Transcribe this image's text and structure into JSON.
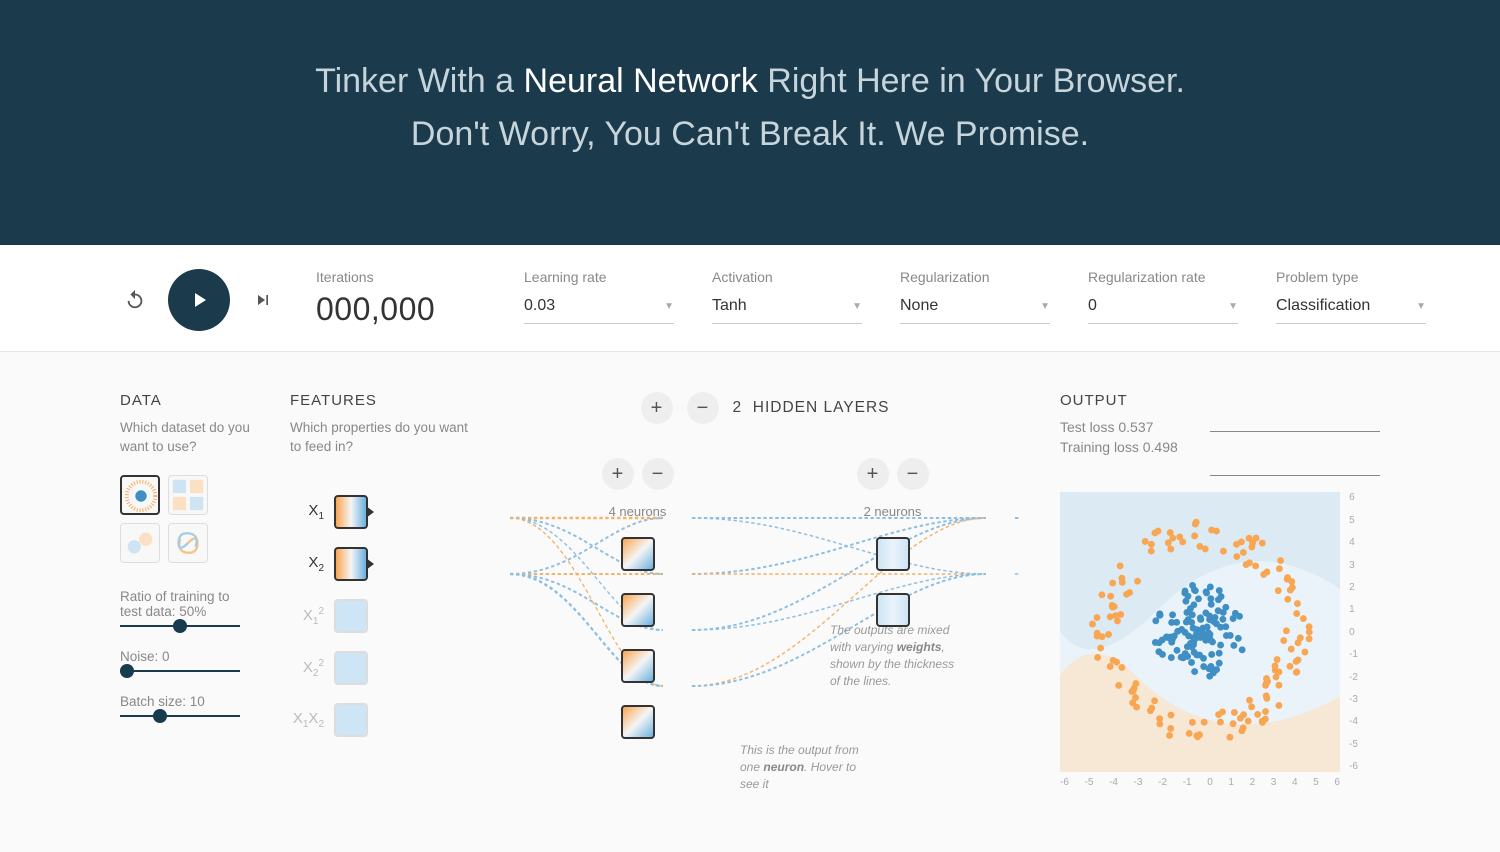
{
  "header": {
    "line1_pre": "Tinker With a ",
    "line1_bold": "Neural Network",
    "line1_post": " Right Here in Your Browser.",
    "line2": "Don't Worry, You Can't Break It. We Promise."
  },
  "controls": {
    "iterations_label": "Iterations",
    "iterations_value": "000,000",
    "learning_rate_label": "Learning rate",
    "learning_rate_value": "0.03",
    "activation_label": "Activation",
    "activation_value": "Tanh",
    "regularization_label": "Regularization",
    "regularization_value": "None",
    "regularization_rate_label": "Regularization rate",
    "regularization_rate_value": "0",
    "problem_type_label": "Problem type",
    "problem_type_value": "Classification"
  },
  "data_panel": {
    "title": "DATA",
    "subtitle": "Which dataset do you want to use?",
    "datasets": [
      "circle",
      "xor",
      "gauss",
      "spiral"
    ],
    "selected_dataset": "circle",
    "ratio_label": "Ratio of training to test data:  ",
    "ratio_value": "50%",
    "noise_label": "Noise:  ",
    "noise_value": "0",
    "batch_label": "Batch size:  ",
    "batch_value": "10"
  },
  "features_panel": {
    "title": "FEATURES",
    "subtitle": "Which properties do you want to feed in?",
    "features": [
      {
        "id": "x1",
        "label_html": "X<sub>1</sub>",
        "active": true,
        "style": "h"
      },
      {
        "id": "x2",
        "label_html": "X<sub>2</sub>",
        "active": true,
        "style": "h"
      },
      {
        "id": "x1sq",
        "label_html": "X<sub>1</sub><sup>2</sup>",
        "active": false,
        "style": "dim"
      },
      {
        "id": "x2sq",
        "label_html": "X<sub>2</sub><sup>2</sup>",
        "active": false,
        "style": "dim"
      },
      {
        "id": "x1x2",
        "label_html": "X<sub>1</sub>X<sub>2</sub>",
        "active": false,
        "style": "dim"
      }
    ]
  },
  "network": {
    "hidden_layers_count": "2",
    "hidden_layers_label": "HIDDEN LAYERS",
    "layers": [
      {
        "neurons": 4,
        "label": "4 neurons"
      },
      {
        "neurons": 2,
        "label": "2 neurons"
      }
    ],
    "callout_weights_1": "The outputs are mixed with varying ",
    "callout_weights_b": "weights",
    "callout_weights_2": ", shown by the thickness of the lines.",
    "callout_neuron_1": "This is the output from one ",
    "callout_neuron_b": "neuron",
    "callout_neuron_2": ". Hover to see it"
  },
  "output": {
    "title": "OUTPUT",
    "test_loss_label": "Test loss ",
    "test_loss_value": "0.537",
    "train_loss_label": "Training loss ",
    "train_loss_value": "0.498",
    "axis_ticks": [
      "-6",
      "-5",
      "-4",
      "-3",
      "-2",
      "-1",
      "0",
      "1",
      "2",
      "3",
      "4",
      "5",
      "6"
    ]
  }
}
